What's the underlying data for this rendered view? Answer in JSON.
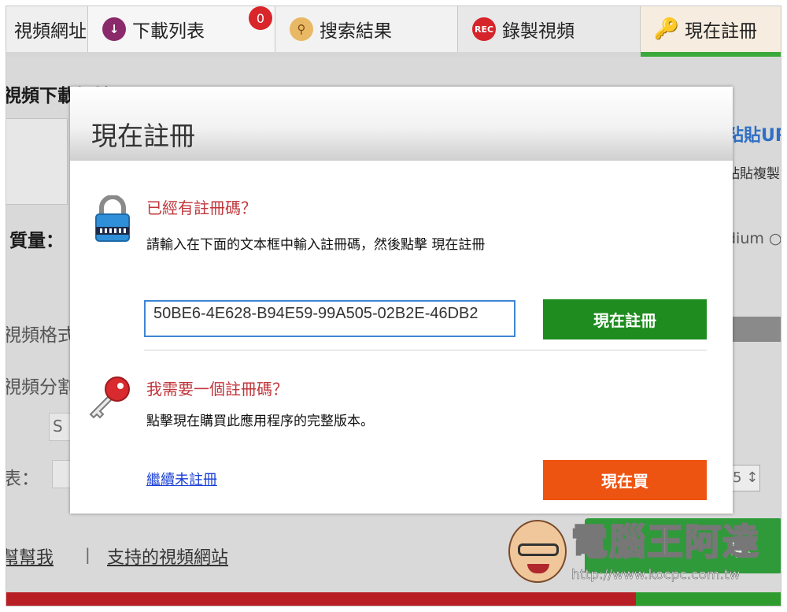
{
  "tabs": {
    "video_url": "視頻網址",
    "download_list": "下載列表",
    "download_count": "0",
    "search_results": "搜索結果",
    "record_video": "錄製視頻",
    "record_icon_text": "REC",
    "register_now": "現在註冊"
  },
  "background": {
    "download_url_label": "視頻下載網址：",
    "paste_url": "粘貼UR",
    "paste_hint": "粘貼複製",
    "quality_label": "質量：",
    "medium_option": "dium",
    "format_label": "視頻格式",
    "split_label": "視頻分割",
    "s_field": "S",
    "table_label": "表：",
    "spin_value": "5",
    "bottom_links": {
      "help": "幫幫我",
      "separator": "|",
      "supported_sites": "支持的視頻網站"
    },
    "download_button_fragment": "載"
  },
  "watermark": {
    "title": "電腦王阿達",
    "url": "http://www.kocpc.com.tw"
  },
  "modal": {
    "title": "現在註冊",
    "have_code_heading": "已經有註冊碼？",
    "have_code_desc": "請輸入在下面的文本框中輸入註冊碼，然後點擊 現在註冊",
    "registration_code": "50BE6-4E628-B94E59-99A505-02B2E-46DB2",
    "register_button": "現在註冊",
    "need_code_heading": "我需要一個註冊碼？",
    "need_code_desc": "點擊現在購買此應用程序的完整版本。",
    "continue_unregistered": "繼續未註冊",
    "buy_button": "現在買"
  },
  "colors": {
    "heading_red": "#c0363c",
    "register_green": "#1e8c1e",
    "buy_orange": "#ee5411",
    "input_border_blue": "#3f86d4",
    "link_blue": "#1a3fd6"
  }
}
